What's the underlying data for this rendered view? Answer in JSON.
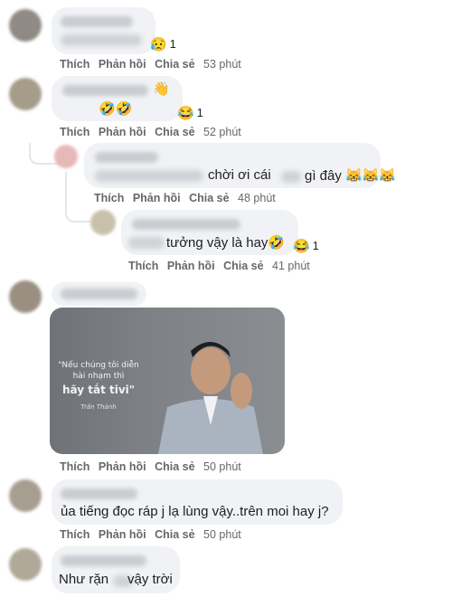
{
  "actions": {
    "like": "Thích",
    "reply": "Phản hồi",
    "share": "Chia sẻ"
  },
  "comments": [
    {
      "text": "",
      "reactions": [
        {
          "icon": "😥",
          "count": "1"
        }
      ],
      "time": "53 phút"
    },
    {
      "text": "🤣🤣",
      "hand": "👋",
      "reactions": [
        {
          "icon": "😂",
          "count": "1"
        }
      ],
      "time": "52 phút"
    },
    {
      "text": "chời ơi cái",
      "text2": "gì đây 😹😹😹",
      "time": "48 phút"
    },
    {
      "text": "tưởng vậy là hay🤣",
      "reactions": [
        {
          "icon": "😂",
          "count": "1"
        }
      ],
      "time": "41 phút"
    },
    {
      "image": {
        "quote": "\"Nếu chúng tôi diễn hài nhạm thì",
        "quote_bold": "hãy tắt tivi\"",
        "signature": "Trấn Thành"
      },
      "time": "50 phút"
    },
    {
      "text": "ủa tiếng đọc ráp j lạ lùng vậy..trên moi hay j?",
      "time": "50 phút"
    },
    {
      "text": "Như rặn",
      "text2": "vậy trời"
    }
  ]
}
